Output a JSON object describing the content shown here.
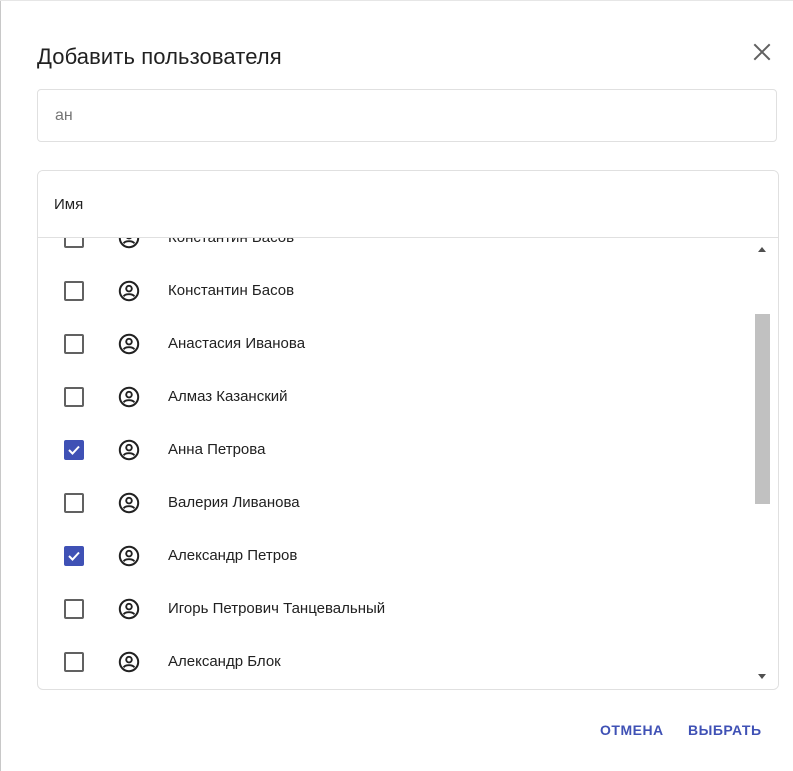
{
  "dialog": {
    "title": "Добавить пользователя",
    "close_icon": "close-icon"
  },
  "search": {
    "value": "ан",
    "placeholder": ""
  },
  "table": {
    "column_header": "Имя",
    "rows": [
      {
        "name": "Константин Басов",
        "checked": false
      },
      {
        "name": "Константин Басов",
        "checked": false
      },
      {
        "name": "Анастасия Иванова",
        "checked": false
      },
      {
        "name": "Алмаз Казанский",
        "checked": false
      },
      {
        "name": "Анна Петрова",
        "checked": true
      },
      {
        "name": "Валерия Ливанова",
        "checked": false
      },
      {
        "name": "Александр Петров",
        "checked": true
      },
      {
        "name": "Игорь Петрович Танцевальный",
        "checked": false
      },
      {
        "name": "Александр Блок",
        "checked": false
      }
    ]
  },
  "actions": {
    "cancel_label": "ОТМЕНА",
    "select_label": "ВЫБРАТЬ"
  },
  "colors": {
    "accent": "#3f51b5",
    "border": "#e0e0e0",
    "text": "#212121"
  }
}
